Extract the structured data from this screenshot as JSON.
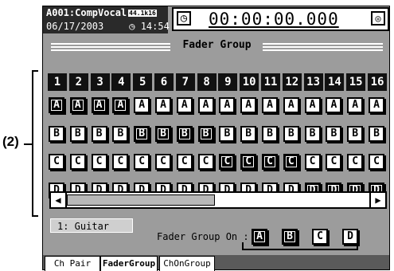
{
  "annotation": {
    "label": "(2)"
  },
  "header": {
    "song_id": "A001:CompVocal",
    "badge": "44.1k16",
    "date": "06/17/2003",
    "time_icon": "clock-icon",
    "time": "14:54",
    "counter": "00:00:00.000"
  },
  "page": {
    "title": "Fader Group"
  },
  "channels": [
    "1",
    "2",
    "3",
    "4",
    "5",
    "6",
    "7",
    "8",
    "9",
    "10",
    "11",
    "12",
    "13",
    "14",
    "15",
    "16"
  ],
  "groups": [
    {
      "letter": "A",
      "on": [
        true,
        true,
        true,
        true,
        false,
        false,
        false,
        false,
        false,
        false,
        false,
        false,
        false,
        false,
        false,
        false
      ]
    },
    {
      "letter": "B",
      "on": [
        false,
        false,
        false,
        false,
        true,
        true,
        true,
        true,
        false,
        false,
        false,
        false,
        false,
        false,
        false,
        false
      ]
    },
    {
      "letter": "C",
      "on": [
        false,
        false,
        false,
        false,
        false,
        false,
        false,
        false,
        true,
        true,
        true,
        true,
        false,
        false,
        false,
        false
      ]
    },
    {
      "letter": "D",
      "on": [
        false,
        false,
        false,
        false,
        false,
        false,
        false,
        false,
        false,
        false,
        false,
        false,
        true,
        true,
        true,
        true
      ]
    }
  ],
  "scroll": {
    "left": "◀",
    "right": "▶"
  },
  "selected_channel": "1: Guitar",
  "fader_group_on": {
    "label": "Fader Group On :",
    "buttons": [
      {
        "letter": "A",
        "on": true
      },
      {
        "letter": "B",
        "on": true
      },
      {
        "letter": "C",
        "on": false
      },
      {
        "letter": "D",
        "on": false
      }
    ]
  },
  "tabs": [
    {
      "label": "Ch Pair",
      "active": false
    },
    {
      "label": "FaderGroup",
      "active": true
    },
    {
      "label": "ChOnGroup",
      "active": false
    }
  ]
}
